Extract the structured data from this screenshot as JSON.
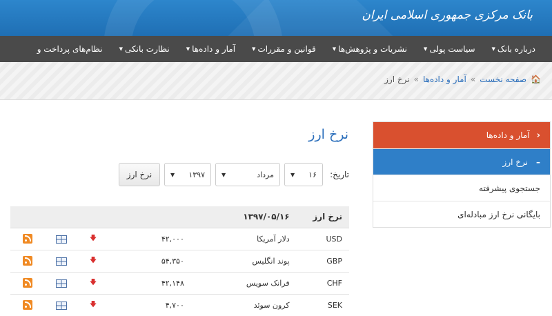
{
  "header": {
    "title": "بانک مرکزی جمهوری اسلامی ایران"
  },
  "nav": {
    "items": [
      {
        "label": "درباره بانک"
      },
      {
        "label": "سیاست پولی"
      },
      {
        "label": "نشریات و پژوهش‌ها"
      },
      {
        "label": "قوانین و مقررات"
      },
      {
        "label": "آمار و داده‌ها"
      },
      {
        "label": "نظارت بانکی"
      },
      {
        "label": "نظام‌های پرداخت و"
      }
    ]
  },
  "breadcrumb": {
    "home": "صفحه نخست",
    "sep": "»",
    "section": "آمار و داده‌ها",
    "current": "نرخ ارز"
  },
  "sidebar": {
    "items": [
      {
        "label": "آمار و داده‌ها"
      },
      {
        "label": "نرخ ارز"
      },
      {
        "label": "جستجوی پیشرفته"
      },
      {
        "label": "بایگانی نرخ ارز مبادله‌ای"
      }
    ]
  },
  "main": {
    "title": "نرخ ارز",
    "filter": {
      "label": "تاریخ:",
      "day": "۱۶",
      "month": "مرداد",
      "year": "۱۳۹۷",
      "submit": "نرخ ارز"
    },
    "table": {
      "headers": {
        "code": "نرخ ارز",
        "date": "۱۳۹۷/۰۵/۱۶"
      },
      "rows": [
        {
          "code": "USD",
          "name": "دلار آمریکا",
          "rate": "۴۲,۰۰۰"
        },
        {
          "code": "GBP",
          "name": "پوند انگلیس",
          "rate": "۵۴,۳۵۰"
        },
        {
          "code": "CHF",
          "name": "فرانک سویس",
          "rate": "۴۲,۱۴۸"
        },
        {
          "code": "SEK",
          "name": "کرون سوئد",
          "rate": "۴,۷۰۰"
        }
      ]
    }
  },
  "colors": {
    "header": "#2479c2",
    "nav": "#4a4a4a",
    "accent_red": "#d9502f",
    "accent_blue": "#2f7fc8",
    "link": "#2a6ebb"
  }
}
